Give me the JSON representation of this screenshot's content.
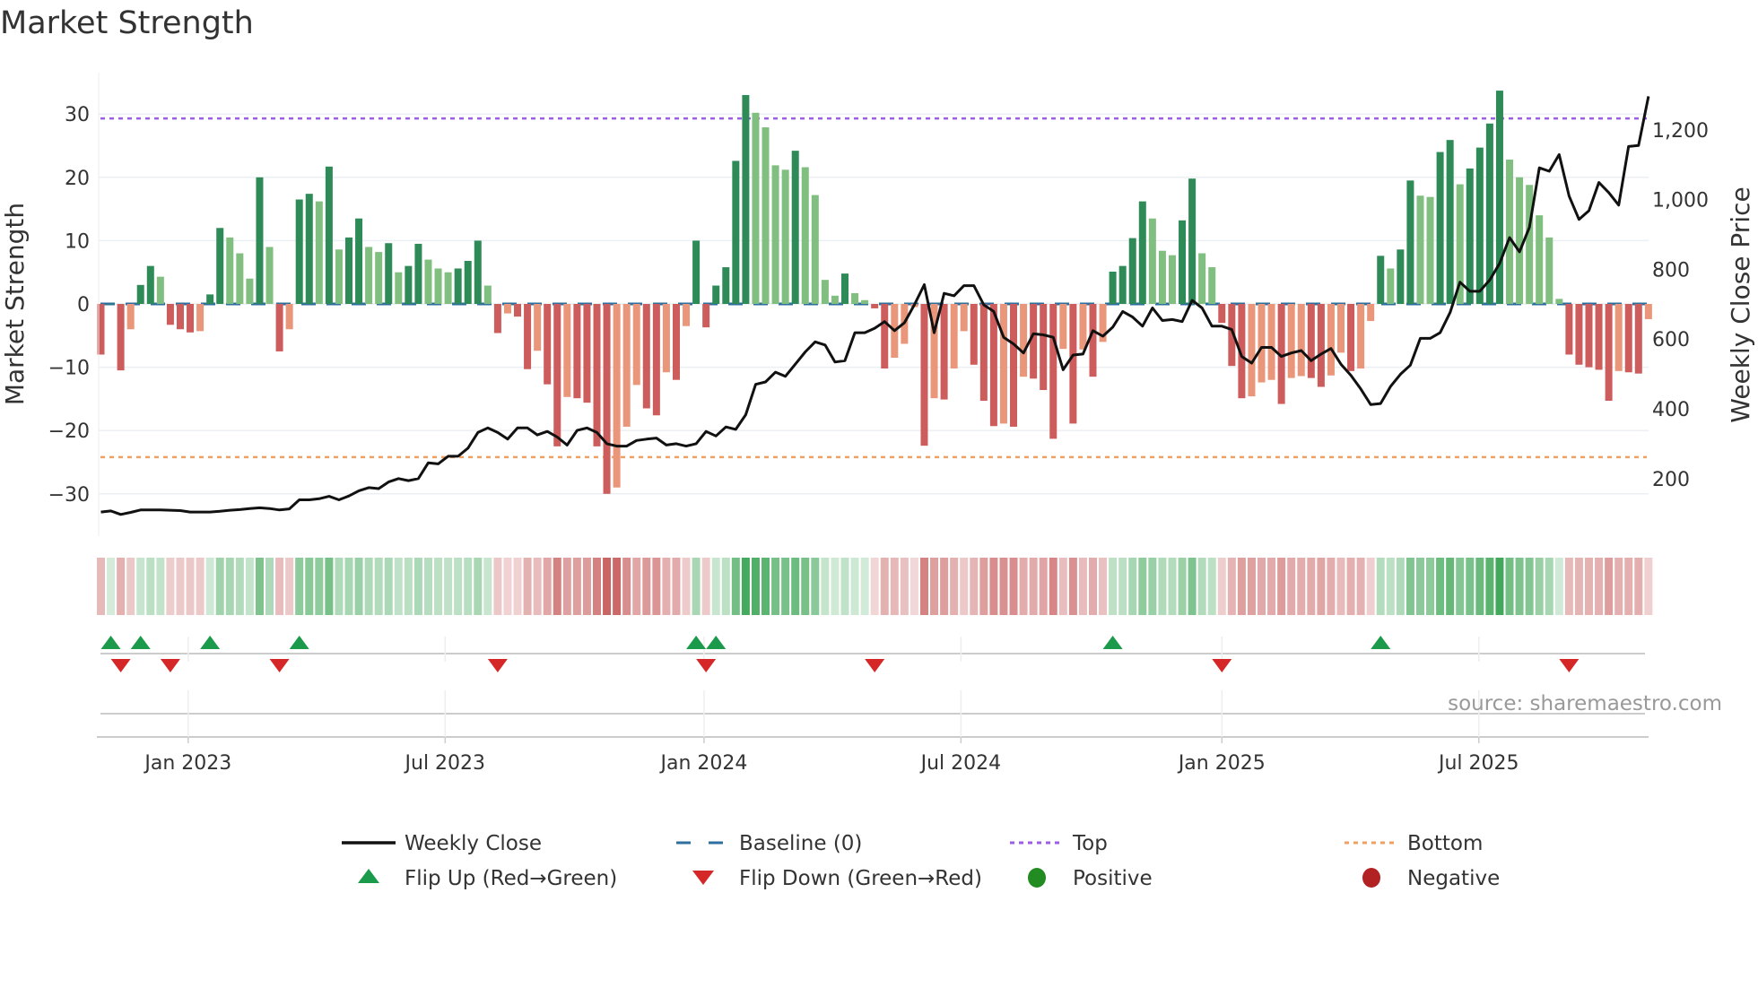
{
  "title": "Market Strength",
  "source": "source: sharemaestro.com",
  "chart_data": {
    "type": "bar",
    "title": "Market Strength",
    "ylabel": "Market Strength",
    "y2label": "Weekly Close Price",
    "ylim": [
      -36.5,
      36.5
    ],
    "yticks": [
      -30,
      -20,
      -10,
      0,
      10,
      20,
      30
    ],
    "ytick_labels": [
      "−30",
      "−20",
      "−10",
      "0",
      "10",
      "20",
      "30"
    ],
    "y2ticks": [
      200,
      400,
      600,
      800,
      1000,
      1200
    ],
    "y2tick_labels": [
      "200",
      "400",
      "600",
      "800",
      "1,000",
      "1,200"
    ],
    "xtick_labels": [
      "Jan 2023",
      "Jul 2023",
      "Jan 2024",
      "Jul 2024",
      "Jan 2025",
      "Jul 2025"
    ],
    "xtick_week_index": [
      8.8,
      34.7,
      60.8,
      86.7,
      113,
      138.9
    ],
    "top_level": 29.3,
    "bottom_level": -24.2,
    "baseline": 0,
    "strength": [
      -8,
      0,
      -10.5,
      -4,
      3,
      6,
      4.3,
      -3.3,
      -4,
      -4.5,
      -4.3,
      1.5,
      12,
      10.5,
      8,
      4,
      20,
      9,
      -7.5,
      -4,
      16.5,
      17.4,
      16.2,
      21.7,
      8.6,
      10.5,
      13.5,
      9,
      8.2,
      9.6,
      5,
      6,
      9.5,
      7,
      5.6,
      5,
      5.6,
      6.8,
      10,
      2.9,
      -4.6,
      -1.5,
      -2,
      -10.3,
      -7.4,
      -12.7,
      -22.5,
      -14.7,
      -14.9,
      -15.6,
      -22.5,
      -30,
      -29,
      -19.4,
      -12.8,
      -16.5,
      -17.6,
      -10.8,
      -12,
      -3.5,
      10,
      -3.7,
      2.9,
      5.8,
      22.6,
      33,
      30.2,
      27.9,
      21.9,
      21.2,
      24.2,
      21.6,
      17.2,
      3.8,
      1.3,
      4.8,
      1.7,
      0.6,
      -0.7,
      -10.2,
      -8.5,
      -6.3,
      -0.5,
      -22.4,
      -14.9,
      -15.1,
      -10.2,
      -4.3,
      -9.6,
      -15.3,
      -19.3,
      -18.9,
      -19.4,
      -11.5,
      -11.8,
      -13.6,
      -21.3,
      -7.1,
      -18.9,
      -7.2,
      -11.5,
      -6,
      5.1,
      6,
      10.4,
      16.2,
      13.5,
      8.4,
      7.7,
      13.2,
      19.8,
      8,
      5.8,
      -3,
      -9.8,
      -14.9,
      -14.6,
      -12.4,
      -12,
      -15.8,
      -11.7,
      -11.4,
      -11.7,
      -13.1,
      -11.3,
      -7.7,
      -10.6,
      -10.2,
      -2.7,
      7.6,
      5.6,
      8.6,
      19.5,
      17.1,
      16.9,
      24,
      25.9,
      18.9,
      21.4,
      24.7,
      28.5,
      33.7,
      22.8,
      20,
      18.8,
      14,
      10.5,
      0.8,
      -8,
      -9.6,
      -10,
      -10.4,
      -15.3,
      -10.6,
      -10.8,
      -11,
      -2.4
    ],
    "weekly_close": [
      104,
      107,
      97,
      103,
      110,
      110,
      110,
      109,
      108,
      104,
      104,
      104,
      106,
      109,
      111,
      114,
      116,
      114,
      110,
      113,
      139,
      139,
      142,
      149,
      139,
      150,
      165,
      174,
      171,
      190,
      200,
      194,
      200,
      245,
      242,
      264,
      264,
      287,
      332,
      345,
      332,
      313,
      345,
      345,
      325,
      335,
      319,
      296,
      338,
      345,
      332,
      300,
      293,
      293,
      309,
      313,
      316,
      296,
      300,
      293,
      300,
      335,
      322,
      348,
      341,
      383,
      470,
      477,
      505,
      493,
      528,
      563,
      592,
      583,
      534,
      538,
      618,
      618,
      631,
      650,
      624,
      647,
      698,
      756,
      618,
      731,
      724,
      753,
      753,
      698,
      679,
      605,
      586,
      560,
      615,
      612,
      605,
      512,
      554,
      557,
      624,
      608,
      634,
      679,
      663,
      637,
      689,
      653,
      656,
      650,
      711,
      689,
      637,
      637,
      627,
      550,
      531,
      576,
      576,
      550,
      560,
      567,
      538,
      557,
      573,
      528,
      496,
      457,
      412,
      415,
      464,
      499,
      525,
      602,
      602,
      618,
      676,
      763,
      737,
      737,
      769,
      817,
      891,
      850,
      920,
      1091,
      1081,
      1129,
      1010,
      943,
      968,
      1049,
      1020,
      984,
      1152,
      1155,
      1296
    ],
    "flip_up_weeks": [
      1,
      4,
      11,
      20,
      60,
      62,
      102,
      129
    ],
    "flip_down_weeks": [
      2,
      7,
      18,
      40,
      61,
      78,
      113,
      148
    ],
    "legend": [
      {
        "label": "Weekly Close",
        "kind": "line"
      },
      {
        "label": "Baseline (0)",
        "kind": "dash"
      },
      {
        "label": "Top",
        "kind": "dotted-purple"
      },
      {
        "label": "Bottom",
        "kind": "dotted-orange"
      },
      {
        "label": "Flip Up (Red→Green)",
        "kind": "triangle-up"
      },
      {
        "label": "Flip Down (Green→Red)",
        "kind": "triangle-down"
      },
      {
        "label": "Positive",
        "kind": "dot-green"
      },
      {
        "label": "Negative",
        "kind": "dot-red"
      }
    ],
    "legend_position": "bottom"
  },
  "colors": {
    "pos_up": "#2e8b57",
    "pos_down": "#80bf80",
    "neg_down": "#cd5c5c",
    "neg_up": "#e9967a",
    "baseline": "#2f6f9f",
    "top": "#9b5de5",
    "bottom": "#f0a060",
    "price": "#111111",
    "flip_up": "#1a9a4a",
    "flip_down": "#d62728",
    "positive": "#228b22",
    "negative": "#b22222"
  }
}
